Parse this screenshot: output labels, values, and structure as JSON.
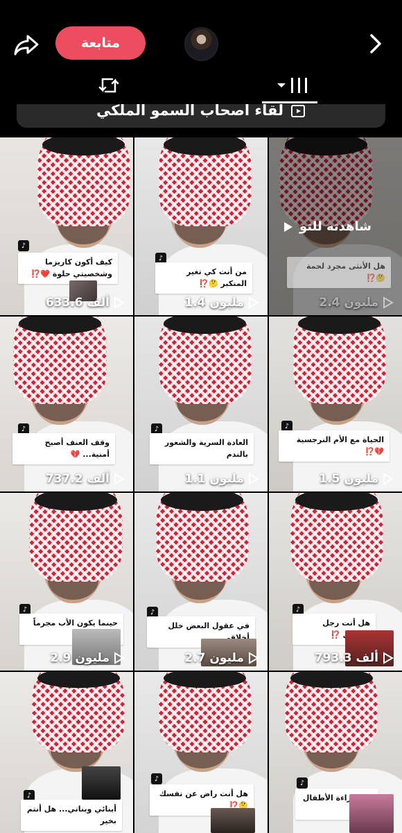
{
  "header": {
    "follow_label": "متابعة",
    "share_icon": "share-icon",
    "chevron_icon": "chevron-right-icon"
  },
  "playlist": {
    "title": "لقاء أصحاب السمو الملكي"
  },
  "colors": {
    "follow_button": "#ee4d5f",
    "background": "#000000",
    "ghutra_red": "#c4283a"
  },
  "videos": [
    {
      "caption": "كيف أكون كاريزما وشخصيتي حلوة ❤️⁉️",
      "views": "633.6 ألف"
    },
    {
      "caption": "من أنت كي تغير المتكبر 🤔⁉️",
      "views": "1.4 مليون"
    },
    {
      "caption": "هل الأنثى مجرد لحمة 🤔⁉️",
      "views": "2.4 مليون",
      "watched_label": "شاهدته للتو"
    },
    {
      "caption": "وقف العنف أصبح أمنية... 💔",
      "views": "737.2 ألف"
    },
    {
      "caption": "العادة السرية والشعور بالندم",
      "views": "1.1 مليون"
    },
    {
      "caption": "الحياة مع الأم النرجسية 💔⁉️",
      "views": "1.5 مليون"
    },
    {
      "caption": "حينما يكون الأب مجرماً ‼️💔",
      "views": "2.9 مليون"
    },
    {
      "caption": "في عقول البعض خلل أخلاقي",
      "views": "2.7 مليون"
    },
    {
      "caption": "هل أنت رجل حقيقي ⁉️",
      "views": "793.3 ألف"
    },
    {
      "caption": "أبنائي وبناتي... هل أنتم بخير",
      "views": ""
    },
    {
      "caption": "هل أنت راض عن نفسك 🤔⁉️",
      "views": ""
    },
    {
      "caption": "جرح براءة الأطفال 💔",
      "views": ""
    }
  ]
}
